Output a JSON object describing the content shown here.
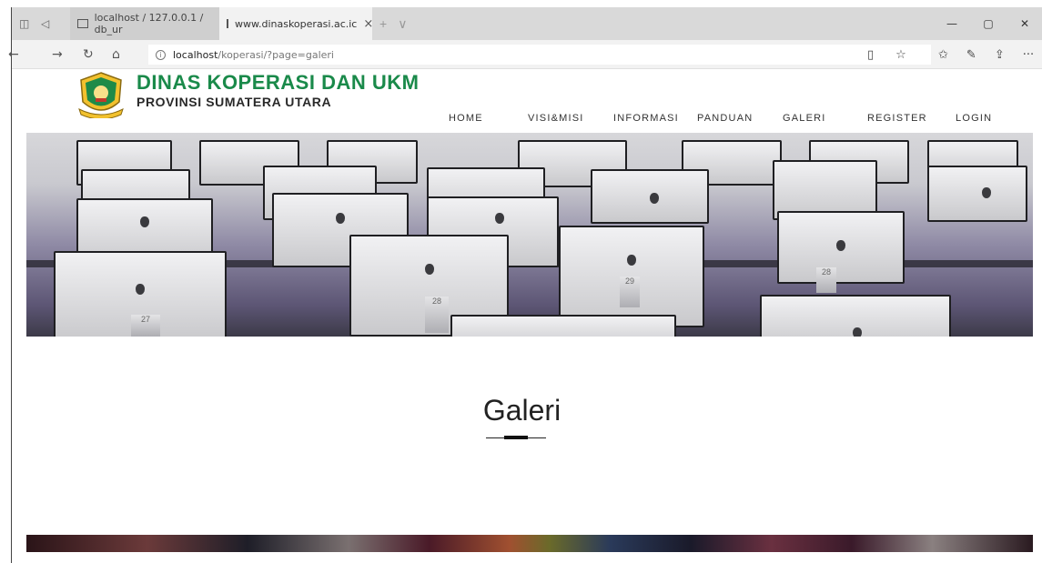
{
  "browser": {
    "tabs": [
      {
        "label": "localhost / 127.0.0.1 / db_ur",
        "active": false
      },
      {
        "label": "www.dinaskoperasi.ac.ic",
        "active": true
      }
    ],
    "close_glyph": "×",
    "new_tab_glyph": "+",
    "tab_list_glyph": "∨",
    "window_controls": {
      "minimize": "—",
      "restore": "▢",
      "close": "✕"
    },
    "url": {
      "host": "localhost",
      "path": "/koperasi/?page=galeri"
    },
    "nav_glyphs": {
      "back": "←",
      "forward": "→",
      "refresh": "↻",
      "home": "⌂"
    },
    "toolbar_glyphs": {
      "reading_view": "▯",
      "favorite": "☆",
      "favorites_hub": "✩",
      "notes": "✎",
      "share": "⇪",
      "more": "···"
    }
  },
  "site": {
    "brand_line1": "DINAS KOPERASI DAN UKM",
    "brand_line2": "PROVINSI SUMATERA UTARA",
    "nav": [
      "HOME",
      "VISI&MISI",
      "INFORMASI",
      "PANDUAN",
      "GALERI",
      "REGISTER",
      "LOGIN"
    ],
    "section_title": "Galeri",
    "hero_monitor_labels": [
      "27",
      "28",
      "29",
      "28"
    ]
  },
  "colors": {
    "brand_green": "#1a8a4a",
    "text_dark": "#222222",
    "hero_purple": "#8f8aa5"
  }
}
